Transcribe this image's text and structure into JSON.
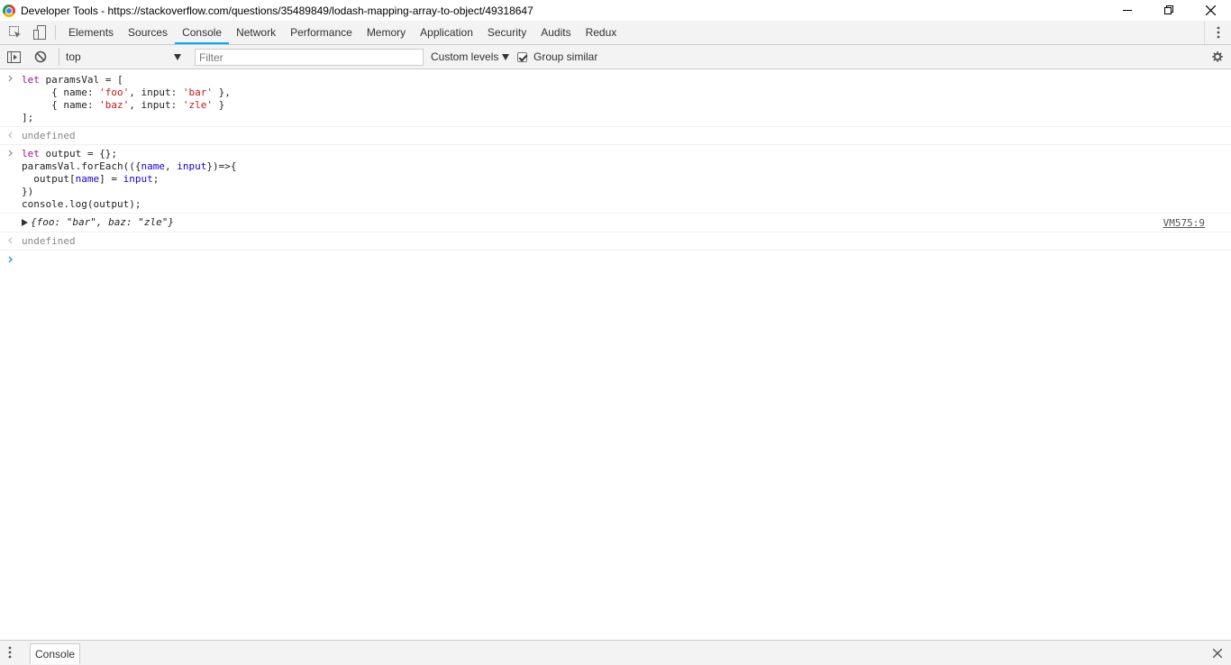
{
  "window": {
    "title": "Developer Tools - https://stackoverflow.com/questions/35489849/lodash-mapping-array-to-object/49318647"
  },
  "tabs": [
    {
      "label": "Elements",
      "selected": false
    },
    {
      "label": "Sources",
      "selected": false
    },
    {
      "label": "Console",
      "selected": true
    },
    {
      "label": "Network",
      "selected": false
    },
    {
      "label": "Performance",
      "selected": false
    },
    {
      "label": "Memory",
      "selected": false
    },
    {
      "label": "Application",
      "selected": false
    },
    {
      "label": "Security",
      "selected": false
    },
    {
      "label": "Audits",
      "selected": false
    },
    {
      "label": "Redux",
      "selected": false
    }
  ],
  "console_toolbar": {
    "context": "top",
    "filter_placeholder": "Filter",
    "levels_label": "Custom levels",
    "group_similar_label": "Group similar",
    "group_similar_checked": true
  },
  "console": {
    "input1_lines": [
      "let paramsVal = [",
      "     { name: 'foo', input: 'bar' },",
      "     { name: 'baz', input: 'zle' }",
      "];"
    ],
    "result1": "undefined",
    "input2_lines": [
      "let output = {};",
      "",
      "",
      "paramsVal.forEach(({name, input})=>{",
      "  output[name] = input;",
      "})",
      "",
      "",
      "console.log(output);"
    ],
    "log_object": "{foo: \"bar\", baz: \"zle\"}",
    "log_source": "VM575:9",
    "result2": "undefined"
  },
  "drawer": {
    "tab_label": "Console"
  },
  "colors": {
    "accent": "#03a9f4",
    "keyword": "#aa0d91",
    "string": "#c41a16",
    "toolbar_bg": "#f3f3f3"
  }
}
